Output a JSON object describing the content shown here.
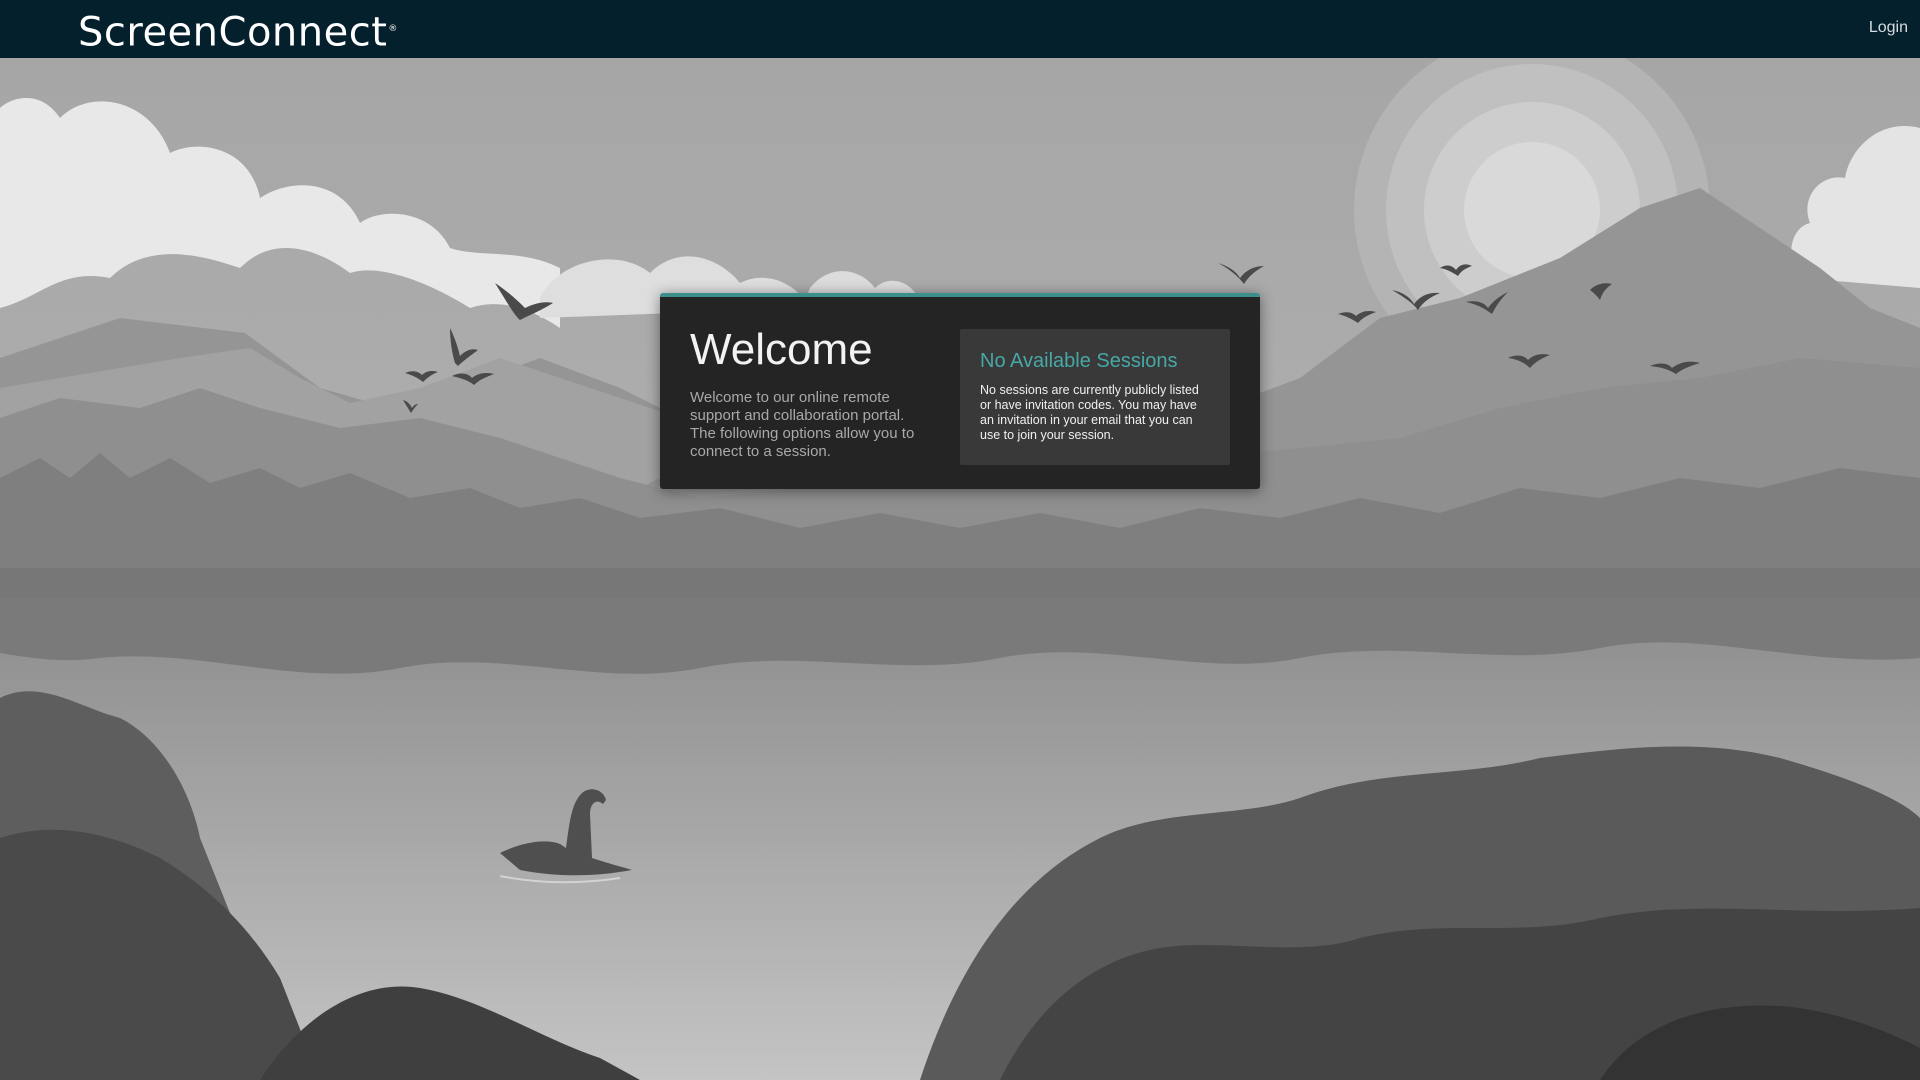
{
  "header": {
    "brand": "ScreenConnect",
    "brand_mark": "®",
    "login_label": "Login"
  },
  "welcome": {
    "title": "Welcome",
    "text": "Welcome to our online remote support and collaboration portal. The following options allow you to connect to a session."
  },
  "sessions": {
    "title": "No Available Sessions",
    "text": "No sessions are currently publicly listed or have invitation codes. You may have an invitation in your email that you can use to join your session."
  },
  "colors": {
    "topbar": "#03202c",
    "accent": "#3d8f8e",
    "sessions_title": "#47a8a6",
    "card_bg": "#242424",
    "panel_bg": "#393939"
  }
}
